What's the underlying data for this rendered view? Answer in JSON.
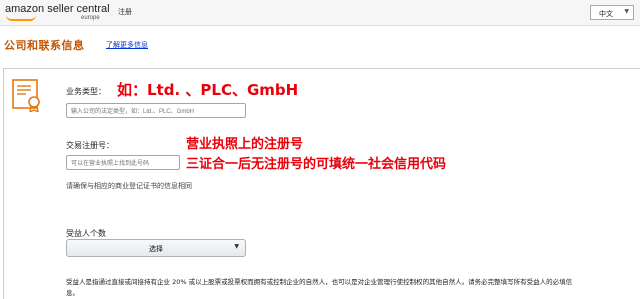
{
  "header": {
    "logo_main": "amazon seller central",
    "logo_sub": "europe",
    "nav_register": "注册",
    "language": "中文"
  },
  "page": {
    "title": "公司和联系信息",
    "learn_more": "了解更多信息"
  },
  "form": {
    "business_type": {
      "label": "业务类型：",
      "placeholder": "输入公司的法定类型，如：Ltd.、PLC、GmbH"
    },
    "registration_number": {
      "label": "交易注册号：",
      "placeholder": "可以在营业执照上找到此号码",
      "hint": "请确保与相应的商业登记证书的信息相同"
    },
    "beneficiaries": {
      "label": "受益人个数",
      "select_value": "选择"
    },
    "footnote_line1": "受益人是指通过直接或间接持有企业 20% 或以上股票或投票权而拥有或控制企业的自然人，也可以是对企业管理行使控制权的其他自然人。请务必完整填写所有受益人的必填信",
    "footnote_line2": "息。"
  },
  "annotations": {
    "business_type_example": "如：Ltd. 、PLC、GmbH",
    "registration_line1": "营业执照上的注册号",
    "registration_line2": "三证合一后无注册号的可填统一社会信用代码"
  },
  "colors": {
    "title": "#c45500",
    "annotation": "#e8000b",
    "link": "#0033cc",
    "icon": "#e47911"
  }
}
